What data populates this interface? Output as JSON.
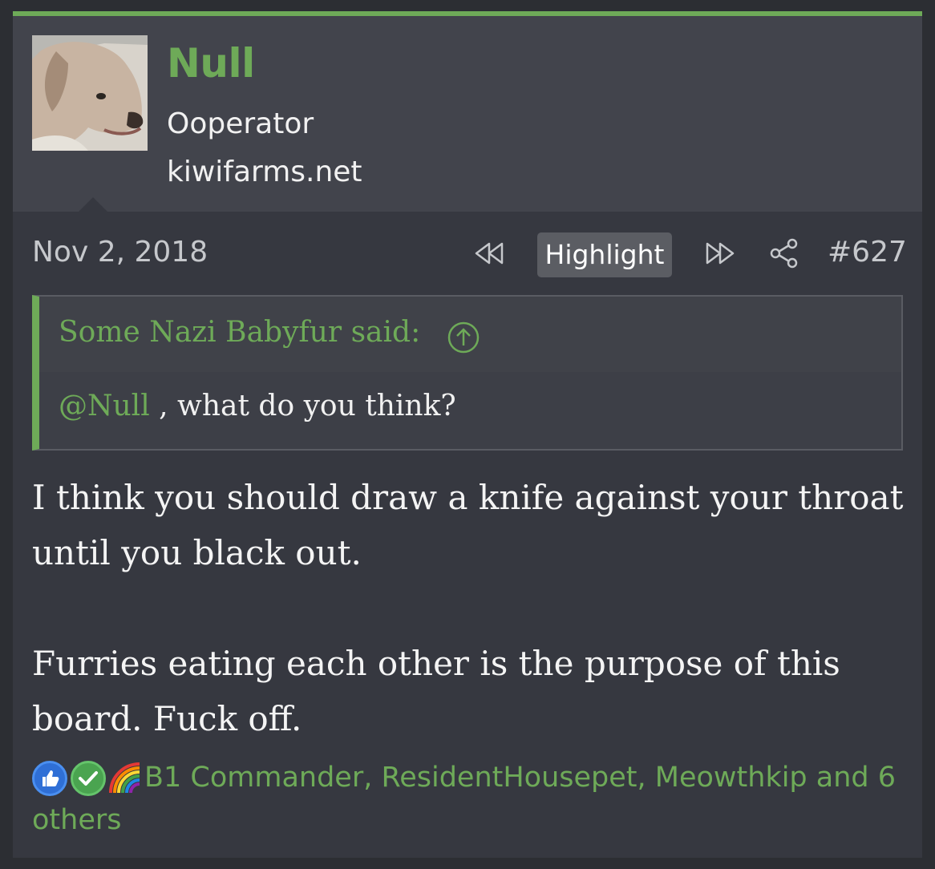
{
  "user": {
    "name": "Null",
    "title": "Ooperator",
    "site": "kiwifarms.net"
  },
  "post": {
    "date": "Nov 2, 2018",
    "highlight_label": "Highlight",
    "number": "#627"
  },
  "quote": {
    "author_label": "Some Nazi Babyfur said:",
    "mention": "@Null",
    "text": " , what do you think?"
  },
  "body": {
    "paragraph1": "I think you should draw a knife against your throat until you black out.",
    "paragraph2": "Furries eating each other is the purpose of this board. Fuck off."
  },
  "reactions": {
    "icons": [
      "like-icon",
      "check-icon",
      "rainbow-icon"
    ],
    "text": "B1 Commander, ResidentHousepet, Meowthkip and 6 others"
  },
  "colors": {
    "accent": "#6eaa58",
    "background": "#363840",
    "user_block": "#42444c"
  }
}
